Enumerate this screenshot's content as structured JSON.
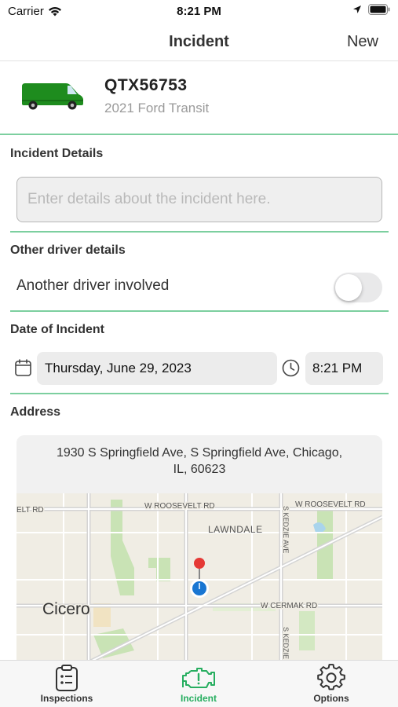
{
  "status_bar": {
    "carrier": "Carrier",
    "time": "8:21 PM"
  },
  "nav": {
    "title": "Incident",
    "right_button": "New"
  },
  "vehicle": {
    "plate": "QTX56753",
    "model": "2021 Ford Transit",
    "icon": "van-icon",
    "color": "#1e8c1e"
  },
  "incident_details": {
    "label": "Incident Details",
    "placeholder": "Enter details about the incident here.",
    "value": ""
  },
  "other_driver": {
    "label": "Other driver details",
    "toggle_label": "Another driver involved",
    "toggle_on": false
  },
  "date_of_incident": {
    "label": "Date of Incident",
    "date": "Thursday, June 29, 2023",
    "time": "8:21 PM"
  },
  "address": {
    "label": "Address",
    "line1": "1930 S Springfield Ave, S Springfield Ave, Chicago,",
    "line2": "IL, 60623",
    "map_labels": {
      "roosevelt_left": "ELT RD",
      "roosevelt_mid": "W ROOSEVELT RD",
      "roosevelt_right": "W ROOSEVELT RD",
      "lawndale": "LAWNDALE",
      "kedzie_upper": "S KEDZIE AVE",
      "kedzie_lower": "S KEDZIE",
      "cicero": "Cicero",
      "cermak": "W CERMAK RD"
    }
  },
  "tabs": [
    {
      "label": "Inspections",
      "icon": "clipboard-icon",
      "active": false
    },
    {
      "label": "Incident",
      "icon": "engine-icon",
      "active": true
    },
    {
      "label": "Options",
      "icon": "gear-icon",
      "active": false
    }
  ],
  "colors": {
    "accent": "#27ae60",
    "divider": "#7ccf9f"
  }
}
